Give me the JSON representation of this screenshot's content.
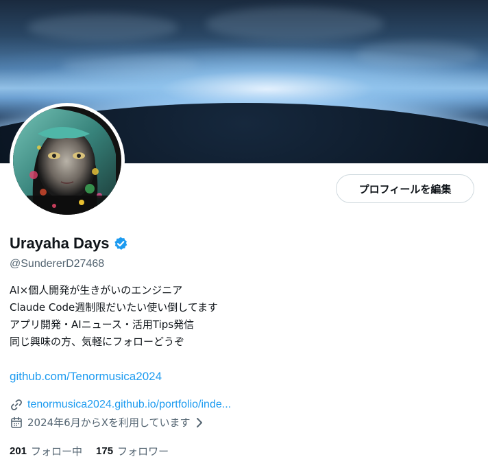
{
  "profile": {
    "display_name": "Urayaha Days",
    "handle": "@SundererD27468",
    "edit_button_label": "プロフィールを編集",
    "bio_lines": [
      "AI×個人開発が生きがいのエンジニア",
      "Claude Code週制限だいたい使い倒してます",
      "アプリ開発・AIニュース・活用Tips発信",
      "同じ興味の方、気軽にフォローどうぞ"
    ],
    "bio_link": "github.com/Tenormusica2024",
    "website": "tenormusica2024.github.io/portfolio/inde...",
    "joined": "2024年6月からXを利用しています",
    "following_count": "201",
    "following_label": "フォロー中",
    "followers_count": "175",
    "followers_label": "フォロワー"
  },
  "icons": {
    "verified": "verified-badge-icon",
    "link": "link-icon",
    "calendar": "calendar-icon",
    "chevron": "chevron-right-icon"
  },
  "colors": {
    "accent": "#1d9bf0",
    "text": "#0f1419",
    "secondary_text": "#536471",
    "border": "#cfd9de"
  }
}
